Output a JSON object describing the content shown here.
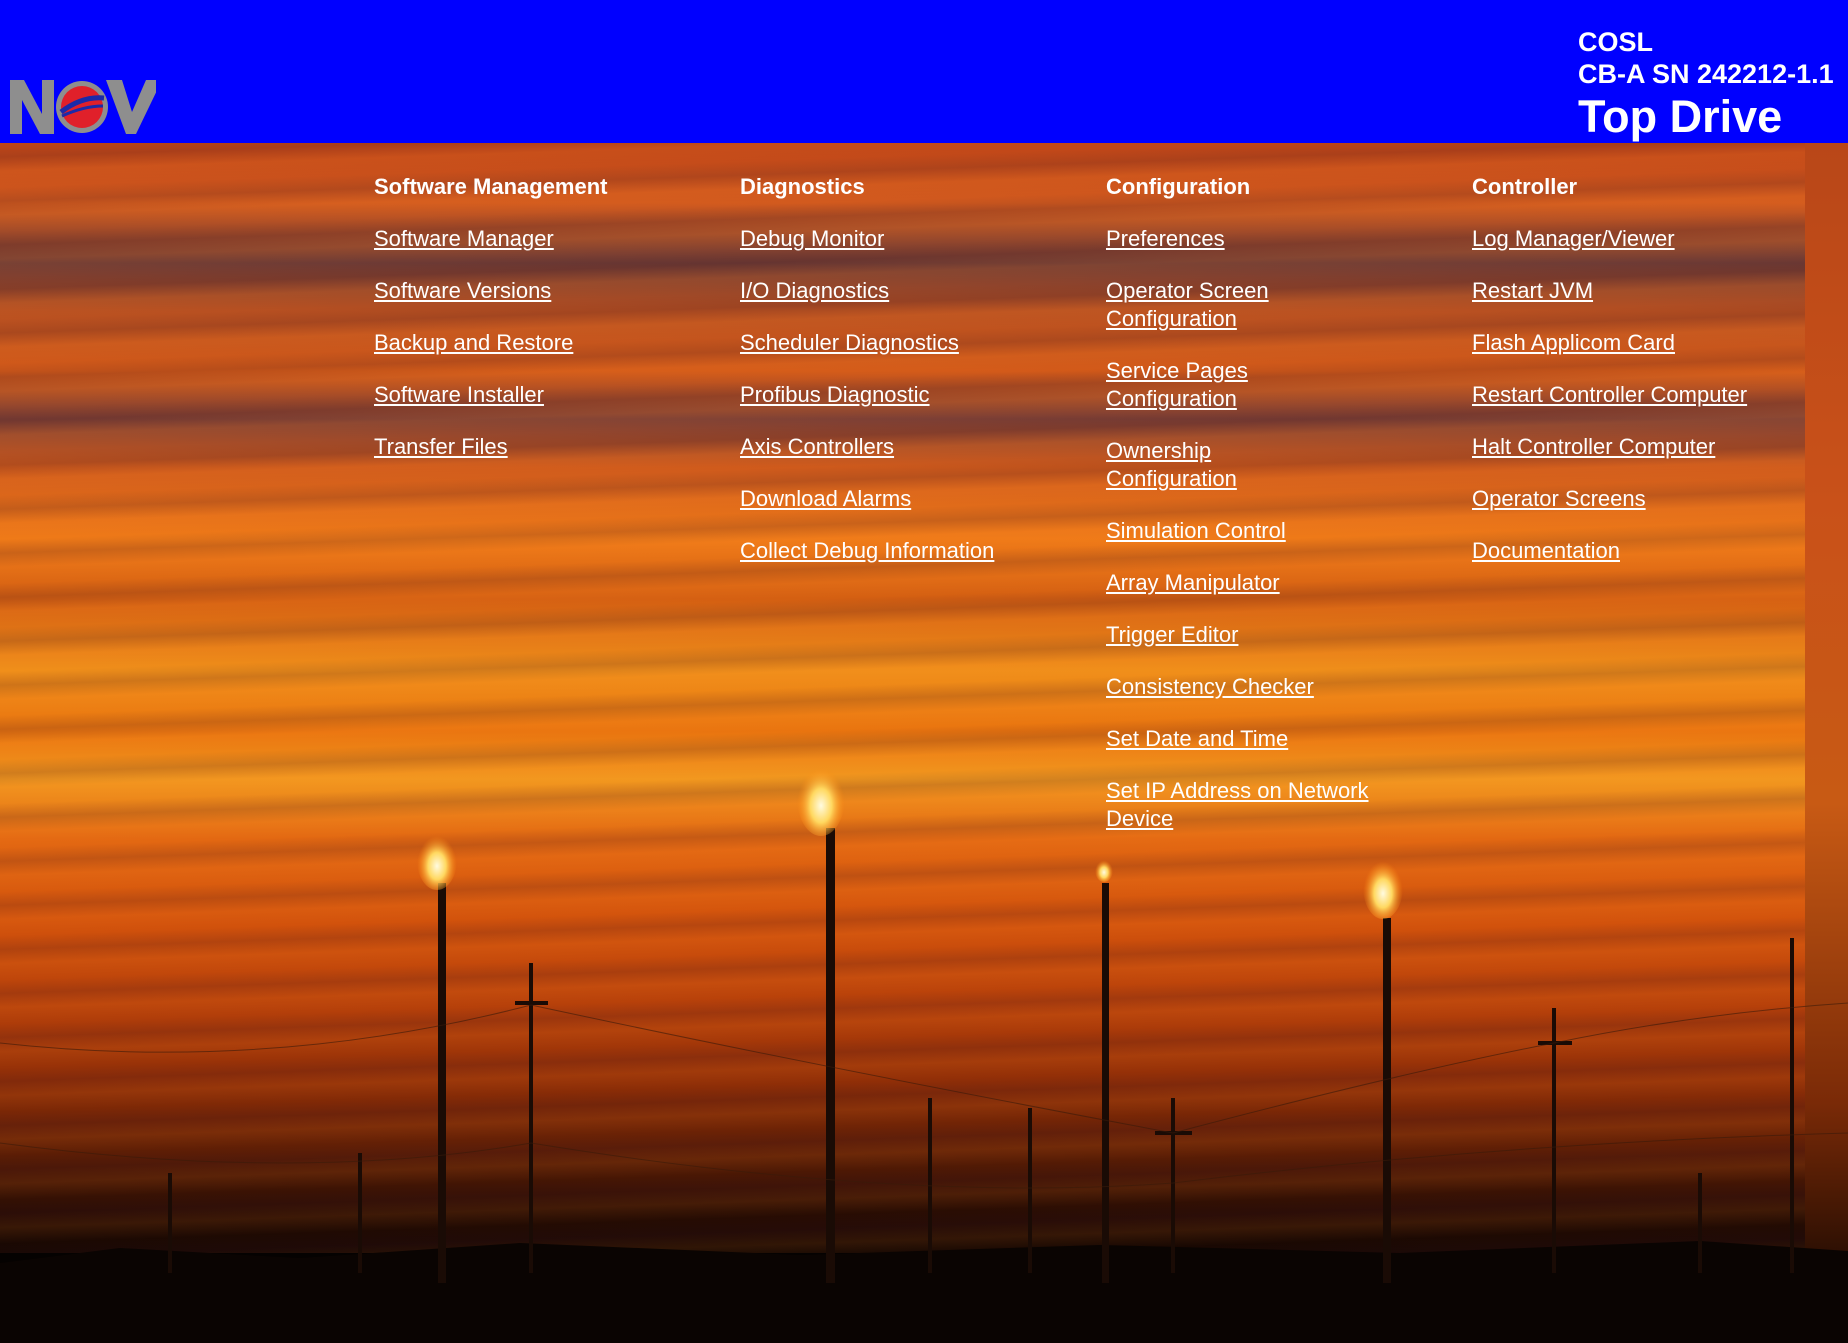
{
  "header": {
    "logo_text": "NOV",
    "customer": "COSL",
    "serial": "CB-A SN 242212-1.1",
    "product": "Top Drive",
    "background_color": "#0000ff"
  },
  "menu": {
    "software_management": {
      "title": "Software Management",
      "links": [
        "Software Manager",
        "Software Versions",
        "Backup and Restore",
        "Software Installer",
        "Transfer Files"
      ]
    },
    "diagnostics": {
      "title": "Diagnostics",
      "links": [
        "Debug Monitor",
        "I/O Diagnostics",
        "Scheduler Diagnostics",
        "Profibus Diagnostic",
        "Axis Controllers",
        "Download Alarms",
        "Collect Debug Information"
      ]
    },
    "configuration": {
      "title": "Configuration",
      "links": [
        "Preferences",
        "Operator Screen Configuration",
        "Service Pages Configuration",
        "Ownership Configuration",
        "Simulation Control",
        "Array Manipulator",
        "Trigger Editor",
        "Consistency Checker",
        "Set Date and Time",
        "Set IP Address on Network Device"
      ]
    },
    "controller": {
      "title": "Controller",
      "links": [
        "Log Manager/Viewer",
        "Restart JVM",
        "Flash Applicom Card",
        "Restart Controller Computer",
        "Halt Controller Computer",
        "Operator Screens",
        "Documentation"
      ]
    }
  }
}
